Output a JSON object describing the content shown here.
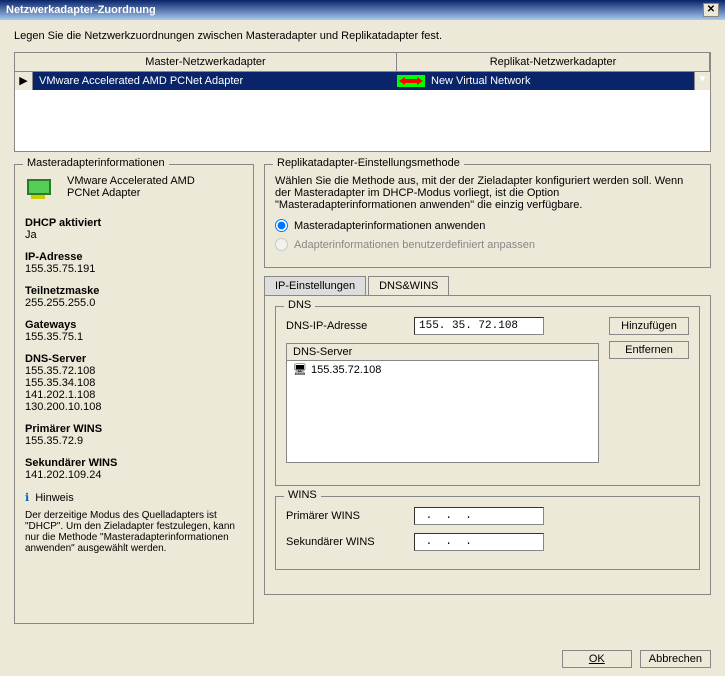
{
  "title": "Netzwerkadapter-Zuordnung",
  "instruction": "Legen Sie die Netzwerkzuordnungen zwischen Masteradapter und Replikatadapter fest.",
  "table": {
    "col1": "Master-Netzwerkadapter",
    "col2": "Replikat-Netzwerkadapter",
    "row": {
      "master": "VMware Accelerated AMD PCNet Adapter",
      "replica": "New Virtual Network"
    }
  },
  "masterInfo": {
    "legend": "Masteradapterinformationen",
    "adapterName": "VMware Accelerated AMD PCNet Adapter",
    "dhcpLabel": "DHCP aktiviert",
    "dhcpVal": "Ja",
    "ipLabel": "IP-Adresse",
    "ipVal": "155.35.75.191",
    "subnetLabel": "Teilnetzmaske",
    "subnetVal": "255.255.255.0",
    "gwLabel": "Gateways",
    "gwVal": "155.35.75.1",
    "dnsLabel": "DNS-Server",
    "dns1": "155.35.72.108",
    "dns2": "155.35.34.108",
    "dns3": "141.202.1.108",
    "dns4": "130.200.10.108",
    "primWinsLabel": "Primärer WINS",
    "primWinsVal": "155.35.72.9",
    "secWinsLabel": "Sekundärer WINS",
    "secWinsVal": "141.202.109.24",
    "hintLabel": "Hinweis",
    "hintText": "Der derzeitige Modus des Quelladapters ist \"DHCP\". Um den Zieladapter festzulegen, kann nur die Methode \"Masteradapterinformationen anwenden\" ausgewählt werden."
  },
  "methodBox": {
    "legend": "Replikatadapter-Einstellungsmethode",
    "desc": "Wählen Sie die Methode aus, mit der der Zieladapter konfiguriert werden soll. Wenn der Masteradapter im DHCP-Modus vorliegt, ist die Option \"Masteradapterinformationen anwenden\" die einzig verfügbare.",
    "opt1": "Masteradapterinformationen anwenden",
    "opt2": "Adapterinformationen benutzerdefiniert anpassen"
  },
  "tabs": {
    "ip": "IP-Einstellungen",
    "dns": "DNS&WINS"
  },
  "dnsBox": {
    "legend": "DNS",
    "ipLabel": "DNS-IP-Adresse",
    "ipValue": "155. 35. 72.108",
    "listHead": "DNS-Server",
    "listItem": "155.35.72.108",
    "addBtn": "Hinzufügen",
    "removeBtn": "Entfernen"
  },
  "winsBox": {
    "legend": "WINS",
    "prim": "Primärer WINS",
    "sec": "Sekundärer WINS",
    "empty": " .  .  . "
  },
  "buttons": {
    "ok": "OK",
    "cancel": "Abbrechen"
  }
}
